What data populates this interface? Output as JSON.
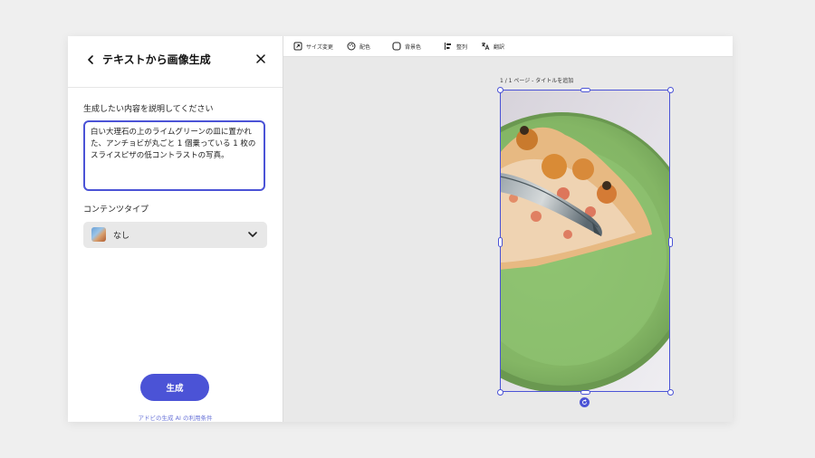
{
  "panel": {
    "title": "テキストから画像生成",
    "prompt_label": "生成したい内容を説明してください",
    "prompt_value": "白い大理石の上のライムグリーンの皿に置かれた、アンチョビが丸ごと 1 個乗っている 1 枚のスライスピザの低コントラストの写真。",
    "content_type_label": "コンテンツタイプ",
    "content_type_value": "なし",
    "generate_label": "生成",
    "terms_link": "アドビの生成 AI の利用条件"
  },
  "toolbar": {
    "resize": "サイズ変更",
    "color": "配色",
    "bg_color": "背景色",
    "align": "整列",
    "translate": "翻訳"
  },
  "canvas": {
    "page_caption": "1 / 1 ページ - タイトルを追加"
  },
  "colors": {
    "accent": "#4b53d6",
    "plate": "#8fbf6e",
    "background": "#e9e9e9"
  }
}
